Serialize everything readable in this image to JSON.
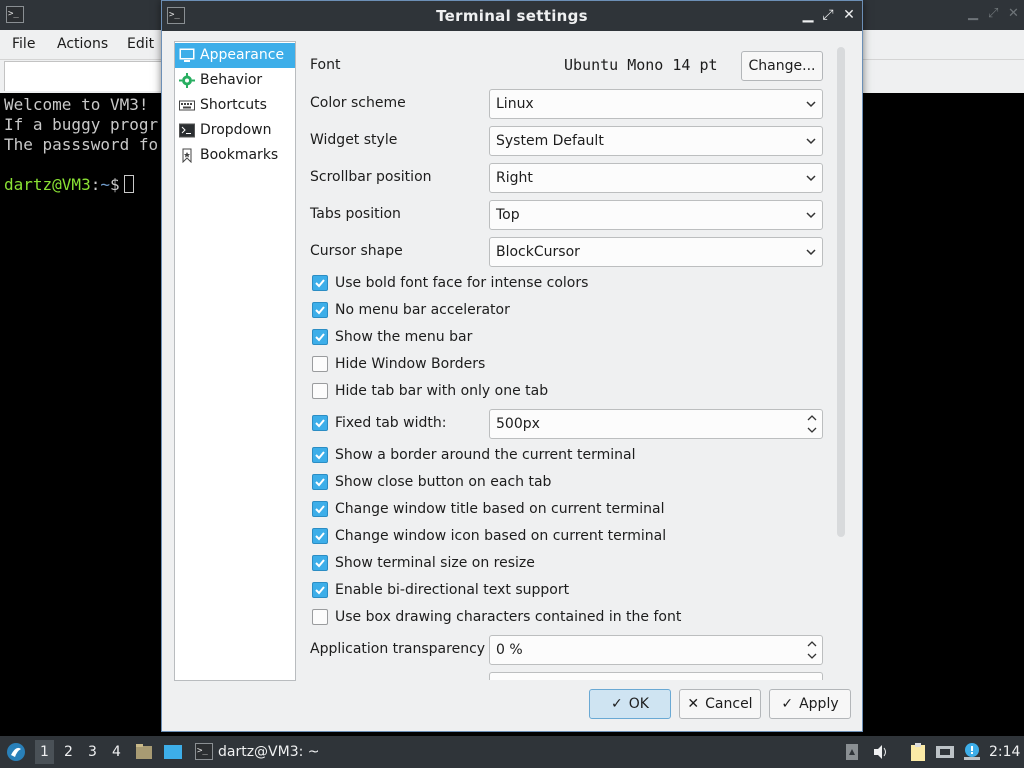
{
  "background_window": {
    "menu": [
      "File",
      "Actions",
      "Edit"
    ],
    "terminal_lines": [
      "Welcome to VM3!",
      "If a buggy progr",
      "The passsword fo"
    ],
    "prompt_user": "dartz@VM3",
    "prompt_sep": ":",
    "prompt_path": "~",
    "prompt_symbol": "$"
  },
  "dialog": {
    "title": "Terminal settings",
    "sidebar": [
      "Appearance",
      "Behavior",
      "Shortcuts",
      "Dropdown",
      "Bookmarks"
    ],
    "font": {
      "label": "Font",
      "value": "Ubuntu Mono 14 pt",
      "button": "Change..."
    },
    "combos": [
      {
        "label": "Color scheme",
        "value": "Linux"
      },
      {
        "label": "Widget style",
        "value": "System Default"
      },
      {
        "label": "Scrollbar position",
        "value": "Right"
      },
      {
        "label": "Tabs position",
        "value": "Top"
      },
      {
        "label": "Cursor shape",
        "value": "BlockCursor"
      }
    ],
    "checkboxes_a": [
      {
        "label": "Use bold font face for intense colors",
        "checked": true
      },
      {
        "label": "No menu bar accelerator",
        "checked": true
      },
      {
        "label": "Show the menu bar",
        "checked": true
      },
      {
        "label": "Hide Window Borders",
        "checked": false
      },
      {
        "label": "Hide tab bar with only one tab",
        "checked": false
      }
    ],
    "fixed_tab": {
      "label": "Fixed tab width:",
      "checked": true,
      "value": "500px"
    },
    "checkboxes_b": [
      {
        "label": "Show a border around the current terminal",
        "checked": true
      },
      {
        "label": "Show close button on each tab",
        "checked": true
      },
      {
        "label": "Change window title based on current terminal",
        "checked": true
      },
      {
        "label": "Change window icon based on current terminal",
        "checked": true
      },
      {
        "label": "Show terminal size on resize",
        "checked": true
      },
      {
        "label": "Enable bi-directional text support",
        "checked": true
      },
      {
        "label": "Use box drawing characters contained in the font",
        "checked": false
      }
    ],
    "transparency": {
      "label": "Application transparency",
      "value": "0 %"
    },
    "buttons": {
      "ok": "OK",
      "cancel": "Cancel",
      "apply": "Apply"
    }
  },
  "taskbar": {
    "desktops": [
      "1",
      "2",
      "3",
      "4"
    ],
    "window_label": "dartz@VM3: ~",
    "clock": "2:14"
  },
  "colors": {
    "accent": "#3daee9",
    "titlebar": "#2f3439",
    "dialog_bg": "#eff0f1",
    "prompt_user": "#8ae234",
    "prompt_path": "#729fcf"
  }
}
